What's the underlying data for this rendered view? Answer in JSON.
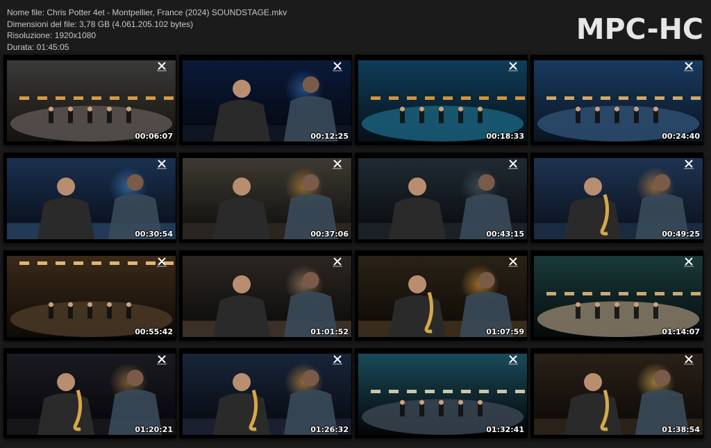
{
  "file_info": {
    "name_line": "Nome file: Chris Potter 4et - Montpellier, France (2024) SOUNDSTAGE.mkv",
    "size_line": "Dimensioni del file: 3,78 GB (4.061.205.102 bytes)",
    "resolution_line": "Risoluzione: 1920x1080",
    "duration_line": "Durata: 01:45:05"
  },
  "brand": {
    "label": "MPC-HC"
  },
  "thumbnails": [
    {
      "time": "00:06:07",
      "scene": "stage-wide-overhead"
    },
    {
      "time": "00:12:25",
      "scene": "pianist-and-drummer-closeup"
    },
    {
      "time": "00:18:33",
      "scene": "stage-wide-blue"
    },
    {
      "time": "00:24:40",
      "scene": "quartet-blue-stage"
    },
    {
      "time": "00:30:54",
      "scene": "pianist-and-drummer-blue"
    },
    {
      "time": "00:37:06",
      "scene": "pianist-profile"
    },
    {
      "time": "00:43:15",
      "scene": "pianist-closeup"
    },
    {
      "time": "00:49:25",
      "scene": "saxophonist-blue"
    },
    {
      "time": "00:55:42",
      "scene": "band-warm-lights"
    },
    {
      "time": "01:01:52",
      "scene": "drummer-and-bassist"
    },
    {
      "time": "01:07:59",
      "scene": "saxophonist-warm"
    },
    {
      "time": "01:14:07",
      "scene": "stage-wide-teal"
    },
    {
      "time": "01:20:21",
      "scene": "sax-and-pianist"
    },
    {
      "time": "01:26:32",
      "scene": "saxophonist-spotlight"
    },
    {
      "time": "01:32:41",
      "scene": "audience-wide"
    },
    {
      "time": "01:38:54",
      "scene": "saxophonist-closeup"
    }
  ],
  "colors": {
    "background": "#1b1b1b",
    "text": "#c8c8c8",
    "brand": "#e6e6e6",
    "timestamp": "#ffffff"
  }
}
